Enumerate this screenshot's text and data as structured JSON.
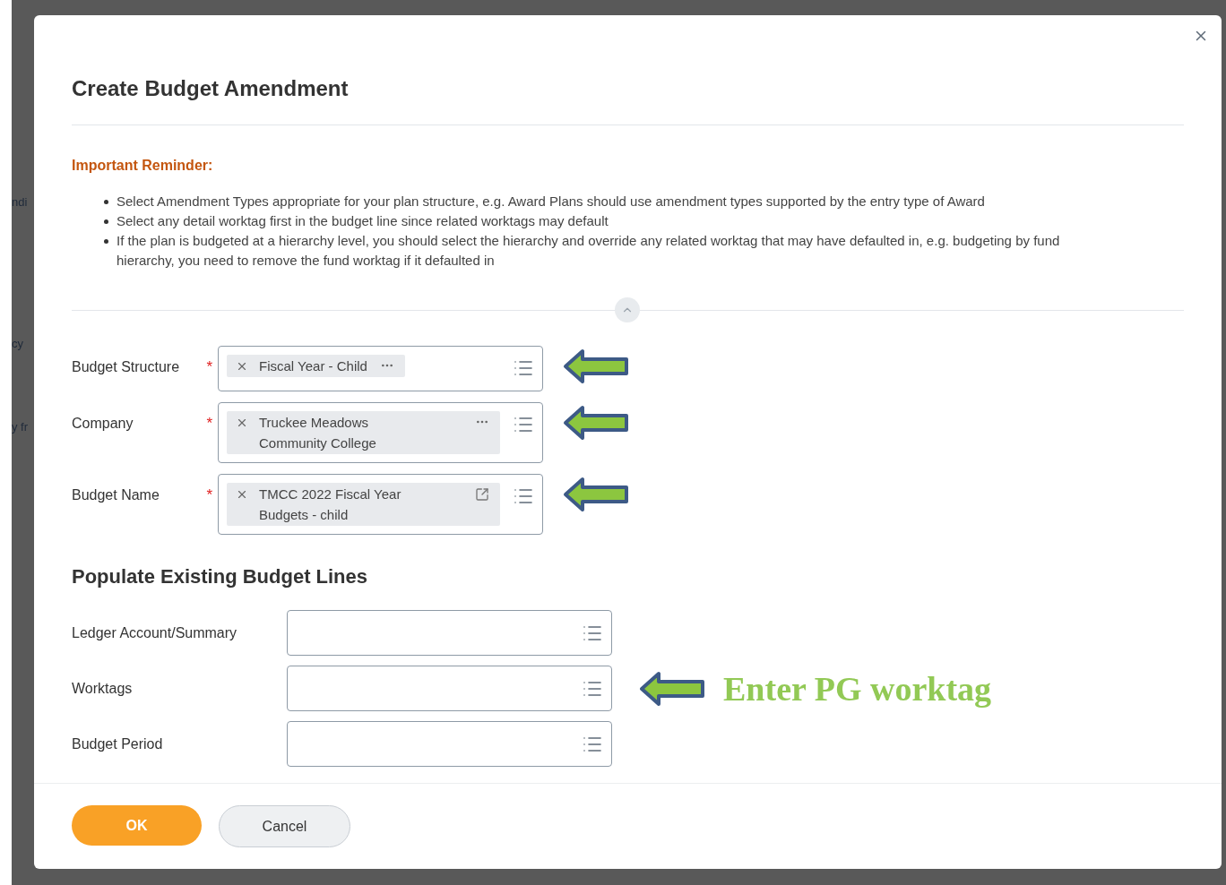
{
  "background_fragments": [
    "ndi",
    "cy",
    "y fr"
  ],
  "dialog": {
    "title": "Create Budget Amendment",
    "reminder": {
      "heading": "Important Reminder:",
      "bullets": [
        "Select Amendment Types appropriate for your plan structure, e.g. Award Plans should use amendment types supported by the entry type of Award",
        "Select any detail worktag first in the budget line since related worktags may default",
        "If the plan is budgeted at a hierarchy level, you should select the hierarchy and override any related worktag that may have defaulted in, e.g. budgeting by fund hierarchy, you need to remove the fund worktag if it defaulted in"
      ]
    },
    "section_expanded": true,
    "fields": [
      {
        "label": "Budget Structure",
        "required_mark": "*",
        "value_lines": [
          "Fiscal Year - Child"
        ],
        "kind": "more",
        "annotated": true
      },
      {
        "label": "Company",
        "required_mark": "*",
        "value_lines": [
          "Truckee Meadows",
          "Community College"
        ],
        "kind": "more",
        "annotated": true
      },
      {
        "label": "Budget Name",
        "required_mark": "*",
        "value_lines": [
          "TMCC 2022 Fiscal Year",
          "Budgets - child"
        ],
        "kind": "link",
        "annotated": true
      }
    ],
    "section_title": "Populate Existing Budget Lines",
    "lines_fields": [
      {
        "label": "Ledger Account/Summary",
        "annotated": false
      },
      {
        "label": "Worktags",
        "annotated": true
      },
      {
        "label": "Budget Period",
        "annotated": false
      }
    ],
    "annotation": {
      "text": "Enter PG worktag"
    },
    "buttons": [
      {
        "label": "OK",
        "kind": "primary"
      },
      {
        "label": "Cancel",
        "kind": "secondary"
      }
    ]
  }
}
